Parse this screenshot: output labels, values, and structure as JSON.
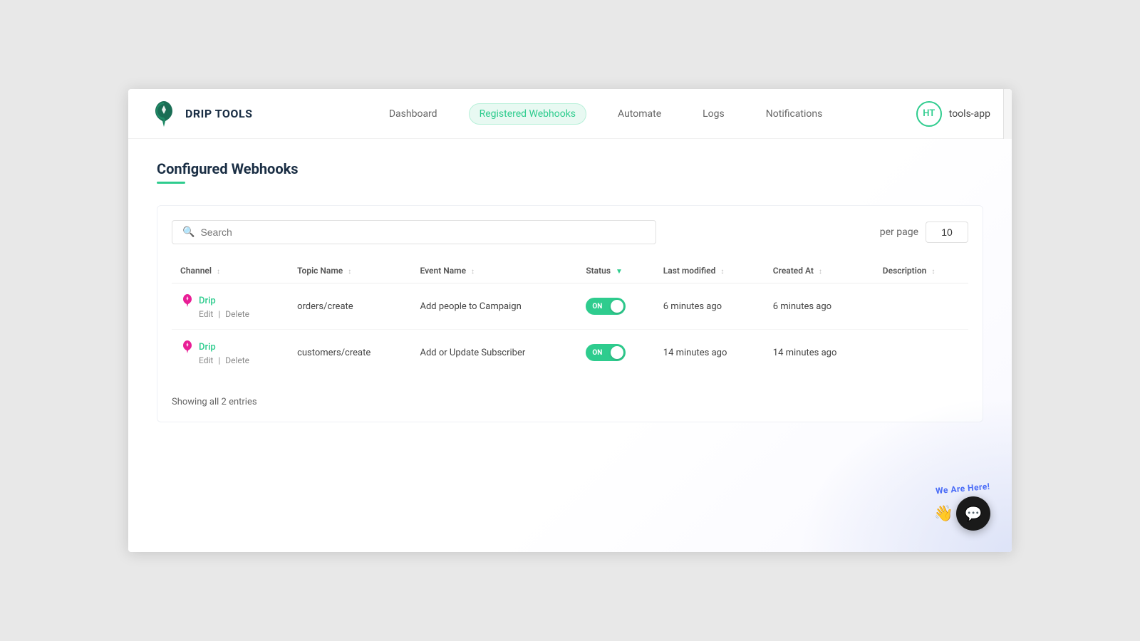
{
  "app": {
    "name": "DRIP TOOLS",
    "user": {
      "initials": "HT",
      "app_name": "tools-app"
    }
  },
  "nav": {
    "items": [
      {
        "label": "Dashboard",
        "active": false
      },
      {
        "label": "Registered Webhooks",
        "active": true
      },
      {
        "label": "Automate",
        "active": false
      },
      {
        "label": "Logs",
        "active": false
      },
      {
        "label": "Notifications",
        "active": false
      }
    ]
  },
  "page": {
    "title": "Configured Webhooks"
  },
  "table": {
    "search_placeholder": "Search",
    "per_page_label": "per page",
    "per_page_value": "10",
    "columns": [
      {
        "label": "Channel",
        "sortable": true
      },
      {
        "label": "Topic Name",
        "sortable": true
      },
      {
        "label": "Event Name",
        "sortable": true
      },
      {
        "label": "Status",
        "sortable": true,
        "active_sort": true
      },
      {
        "label": "Last modified",
        "sortable": true
      },
      {
        "label": "Created At",
        "sortable": true
      },
      {
        "label": "Description",
        "sortable": true
      }
    ],
    "rows": [
      {
        "channel": "Drip",
        "topic_name": "orders/create",
        "event_name": "Add people to Campaign",
        "status": "ON",
        "status_on": true,
        "last_modified": "6 minutes ago",
        "created_at": "6 minutes ago",
        "description": ""
      },
      {
        "channel": "Drip",
        "topic_name": "customers/create",
        "event_name": "Add or Update Subscriber",
        "status": "ON",
        "status_on": true,
        "last_modified": "14 minutes ago",
        "created_at": "14 minutes ago",
        "description": ""
      }
    ],
    "showing_text": "Showing all 2 entries",
    "edit_label": "Edit",
    "delete_label": "Delete"
  },
  "chat": {
    "label": "We Are Here!",
    "emoji": "👋"
  }
}
